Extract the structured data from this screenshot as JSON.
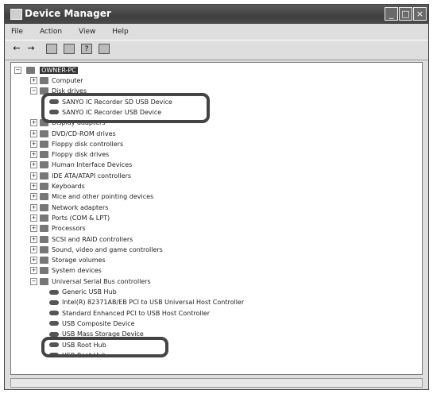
{
  "window": {
    "title": "Device Manager"
  },
  "menu": [
    "File",
    "Action",
    "View",
    "Help"
  ],
  "toolbar": {
    "back": "←",
    "forward": "→",
    "icons": [
      "properties-icon",
      "print-icon",
      "help-icon",
      "grid-icon"
    ]
  },
  "tree": {
    "root": "OWNER-PC",
    "items": [
      {
        "label": "Computer",
        "expander": "+"
      },
      {
        "label": "Disk drives",
        "expander": "−"
      },
      {
        "label": "SANYO IC Recorder SD USB Device",
        "child": true
      },
      {
        "label": "SANYO IC Recorder USB Device",
        "child": true
      },
      {
        "label": "Display adapters",
        "expander": "+"
      },
      {
        "label": "DVD/CD-ROM drives",
        "expander": "+"
      },
      {
        "label": "Floppy disk controllers",
        "expander": "+"
      },
      {
        "label": "Floppy disk drives",
        "expander": "+"
      },
      {
        "label": "Human Interface Devices",
        "expander": "+"
      },
      {
        "label": "IDE ATA/ATAPI controllers",
        "expander": "+"
      },
      {
        "label": "Keyboards",
        "expander": "+"
      },
      {
        "label": "Mice and other pointing devices",
        "expander": "+"
      },
      {
        "label": "Network adapters",
        "expander": "+"
      },
      {
        "label": "Ports (COM & LPT)",
        "expander": "+"
      },
      {
        "label": "Processors",
        "expander": "+"
      },
      {
        "label": "SCSI and RAID controllers",
        "expander": "+"
      },
      {
        "label": "Sound, video and game controllers",
        "expander": "+"
      },
      {
        "label": "Storage volumes",
        "expander": "+"
      },
      {
        "label": "System devices",
        "expander": "+"
      },
      {
        "label": "Universal Serial Bus controllers",
        "expander": "−"
      },
      {
        "label": "Generic USB Hub",
        "child": true
      },
      {
        "label": "Intel(R) 82371AB/EB PCI to USB Universal Host Controller",
        "child": true
      },
      {
        "label": "Standard Enhanced PCI to USB Host Controller",
        "child": true
      },
      {
        "label": "USB Composite Device",
        "child": true
      },
      {
        "label": "USB Mass Storage Device",
        "child": true
      },
      {
        "label": "USB Root Hub",
        "child": true
      },
      {
        "label": "USB Root Hub",
        "child": true
      }
    ]
  }
}
